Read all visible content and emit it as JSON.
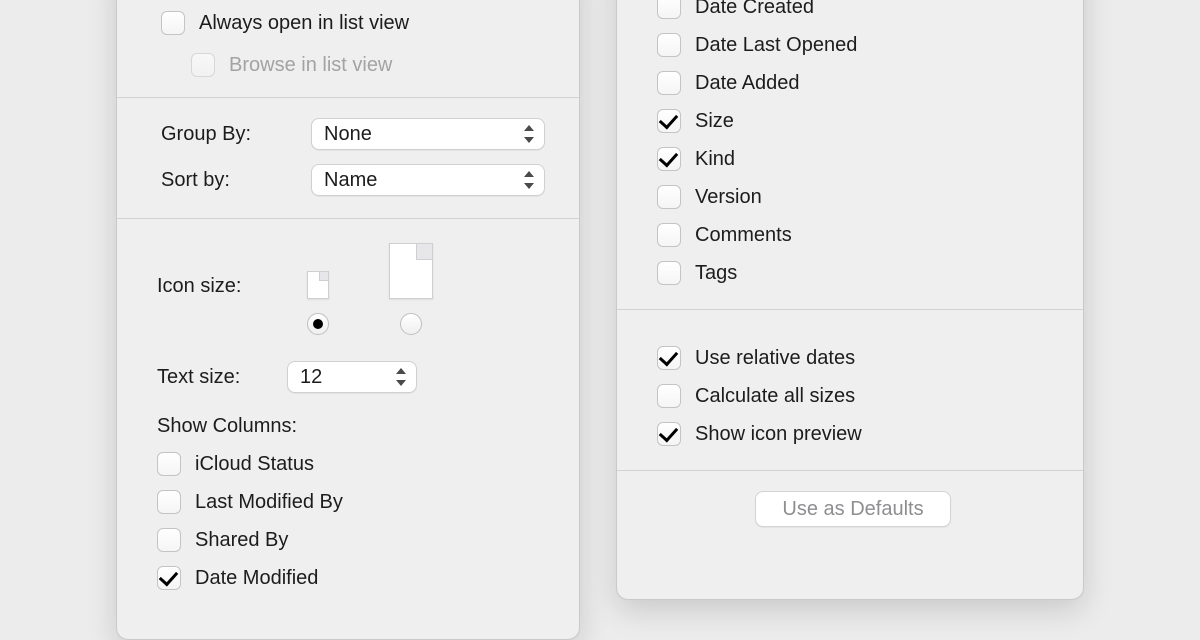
{
  "left": {
    "always_open": {
      "label": "Always open in list view",
      "checked": false
    },
    "browse": {
      "label": "Browse in list view",
      "checked": false,
      "disabled": true
    },
    "group_by": {
      "label": "Group By:",
      "value": "None"
    },
    "sort_by": {
      "label": "Sort by:",
      "value": "Name"
    },
    "icon_size": {
      "label": "Icon size:",
      "selected": "small"
    },
    "text_size": {
      "label": "Text size:",
      "value": "12"
    },
    "show_columns_header": "Show Columns:",
    "columns": [
      {
        "id": "icloud-status",
        "label": "iCloud Status",
        "checked": false
      },
      {
        "id": "last-modified-by",
        "label": "Last Modified By",
        "checked": false
      },
      {
        "id": "shared-by",
        "label": "Shared By",
        "checked": false
      },
      {
        "id": "date-modified",
        "label": "Date Modified",
        "checked": true
      }
    ]
  },
  "right": {
    "columns": [
      {
        "id": "date-created",
        "label": "Date Created",
        "checked": false
      },
      {
        "id": "date-last-opened",
        "label": "Date Last Opened",
        "checked": false
      },
      {
        "id": "date-added",
        "label": "Date Added",
        "checked": false
      },
      {
        "id": "size",
        "label": "Size",
        "checked": true
      },
      {
        "id": "kind",
        "label": "Kind",
        "checked": true
      },
      {
        "id": "version",
        "label": "Version",
        "checked": false
      },
      {
        "id": "comments",
        "label": "Comments",
        "checked": false
      },
      {
        "id": "tags",
        "label": "Tags",
        "checked": false
      }
    ],
    "options": [
      {
        "id": "relative-dates",
        "label": "Use relative dates",
        "checked": true
      },
      {
        "id": "calculate-sizes",
        "label": "Calculate all sizes",
        "checked": false
      },
      {
        "id": "show-icon-preview",
        "label": "Show icon preview",
        "checked": true
      }
    ],
    "defaults_button": "Use as Defaults"
  }
}
